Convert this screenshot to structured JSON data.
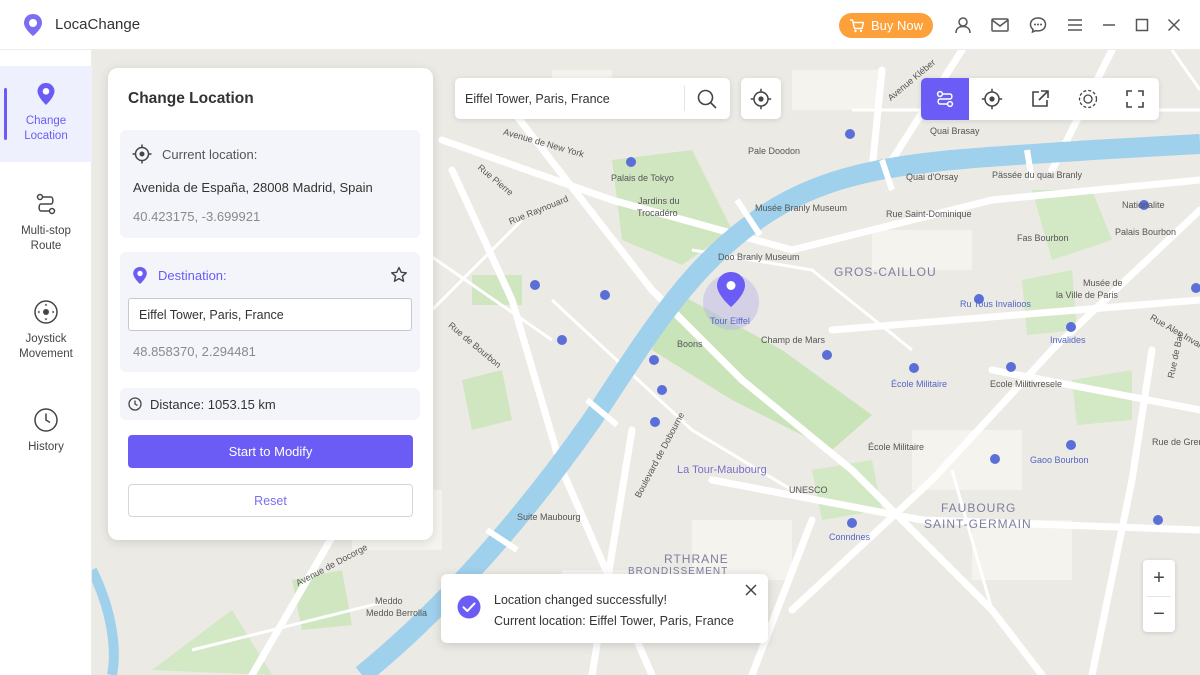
{
  "app": {
    "title": "LocaChange",
    "buy_label": "Buy Now",
    "accent": "#6a5cf5",
    "buy_color": "#fda03a"
  },
  "titlebar_icons": [
    "user-icon",
    "mail-icon",
    "chat-icon",
    "menu-icon",
    "minimize-icon",
    "maximize-icon",
    "close-icon"
  ],
  "nav": [
    {
      "id": "change-location",
      "line1": "Change",
      "line2": "Location",
      "icon": "pin-icon",
      "active": true
    },
    {
      "id": "multi-stop-route",
      "line1": "Multi-stop",
      "line2": "Route",
      "icon": "route-icon",
      "active": false
    },
    {
      "id": "joystick-movement",
      "line1": "Joystick",
      "line2": "Movement",
      "icon": "joystick-icon",
      "active": false
    },
    {
      "id": "history",
      "line1": "History",
      "line2": "",
      "icon": "clock-icon",
      "active": false
    }
  ],
  "panel": {
    "title": "Change Location",
    "current_label": "Current location:",
    "current_address": "Avenida de España, 28008 Madrid, Spain",
    "current_coords": "40.423175, -3.699921",
    "destination_label": "Destination:",
    "destination_value": "Eiffel Tower, Paris, France",
    "destination_coords": "48.858370, 2.294481",
    "distance": "Distance: 1053.15 km",
    "start_label": "Start to Modify",
    "reset_label": "Reset"
  },
  "search": {
    "value": "Eiffel Tower, Paris, France"
  },
  "toolbar": [
    {
      "id": "route-mode",
      "icon": "sliders-icon",
      "active": true
    },
    {
      "id": "teleport-mode",
      "icon": "target-icon",
      "active": false
    },
    {
      "id": "export",
      "icon": "export-icon",
      "active": false
    },
    {
      "id": "gps-toggle",
      "icon": "gps-icon",
      "active": false
    },
    {
      "id": "fullscreen",
      "icon": "fullscreen-icon",
      "active": false
    }
  ],
  "zoom": {
    "in": "+",
    "out": "−"
  },
  "toast": {
    "line1": "Location changed successfully!",
    "line2": "Current location: Eiffel Tower, Paris, France"
  },
  "map": {
    "pin_label": "Tour Eiffel",
    "labels": {
      "quai_brasay": "Quai Brasay",
      "avenue_new_york": "Avenue de New York",
      "palais_tokyo": "Palais de Tokyo",
      "jardins": "Jardins du",
      "trocadero": "Trocadéro",
      "pale_doodon": "Pale Doodon",
      "quai_dorsay": "Quai d'Orsay",
      "passee_quai_branly": "Pässée du quai Branly",
      "nationalite": "Nationalite",
      "musee_branly": "Musée Branly Museum",
      "rue_st_dominique": "Rue Saint-Dominique",
      "palais_bourbon": "Palais Bourbon",
      "fas_bourbon": "Fas Bourbon",
      "gros_caillou": "GROS-CAILLOU",
      "doo_branly": "Doo Branly Museum",
      "musee_ville": "Musée de",
      "musee_ville2": "la Ville de Paris",
      "ru_invalides": "Ru Tous Invalioos",
      "invalides": "Invalides",
      "champ_de_mars": "Champ de Mars",
      "boons": "Boons",
      "ecole_militaire1": "École Militaire",
      "ecole_militaire2": "École Militaire",
      "ecole_universelle": "Ecole Militivresele",
      "la_tour_maubourg": "La Tour-Maubourg",
      "unesco": "UNESCO",
      "bd_dobourne": "Boulevard de Dobourne",
      "ave_bourbon": "Rue de Bourbon",
      "suite_maubourg": "Suite Maubourg",
      "faubourg1": "FAUBOURG",
      "faubourg2": "SAINT-GERMAIN",
      "conndnes": "Conndnes",
      "gaoo_bourbon": "Gaoo Bourbon",
      "rue_de_bac": "Rue de Bac",
      "rue_de_grenelle": "Rue de Grenelle",
      "avenue_docorge": "Avenue de Docorge",
      "rthrane": "RTHRANE",
      "rthrane2": "BRONDISSEMENT",
      "meddo": "Meddo",
      "meddo2": "Meddo Berrolla",
      "rue_pierre": "Rue Pierre",
      "rue_bourbon2": "Rue Raynouard",
      "rue_lamartine": "Avenue Kléber",
      "rue_invalides": "Rue Ales Invalides"
    }
  }
}
